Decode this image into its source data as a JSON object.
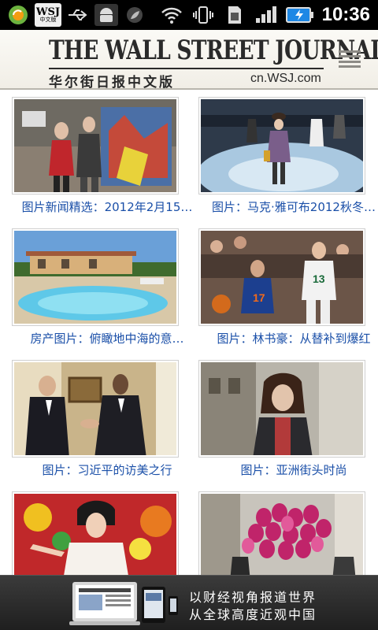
{
  "status_bar": {
    "app_label_top": "WSJ",
    "app_label_bottom": "中文版",
    "time": "10:36"
  },
  "header": {
    "masthead": "THE WALL STREET JOURNAL.",
    "subtitle": "华尔街日报中文版",
    "url": "cn.WSJ.com"
  },
  "tiles": [
    {
      "caption": "图片新闻精选：2012年2月15…"
    },
    {
      "caption": "图片：马克·雅可布2012秋冬…"
    },
    {
      "caption": "房产图片：俯瞰地中海的意…"
    },
    {
      "caption": "图片：林书豪：从替补到爆红"
    },
    {
      "caption": "图片：习近平的访美之行"
    },
    {
      "caption": "图片：亚洲街头时尚"
    },
    {
      "caption": ""
    },
    {
      "caption": ""
    }
  ],
  "ad": {
    "line1": "以财经视角报道世界",
    "line2": "从全球高度近观中国"
  }
}
